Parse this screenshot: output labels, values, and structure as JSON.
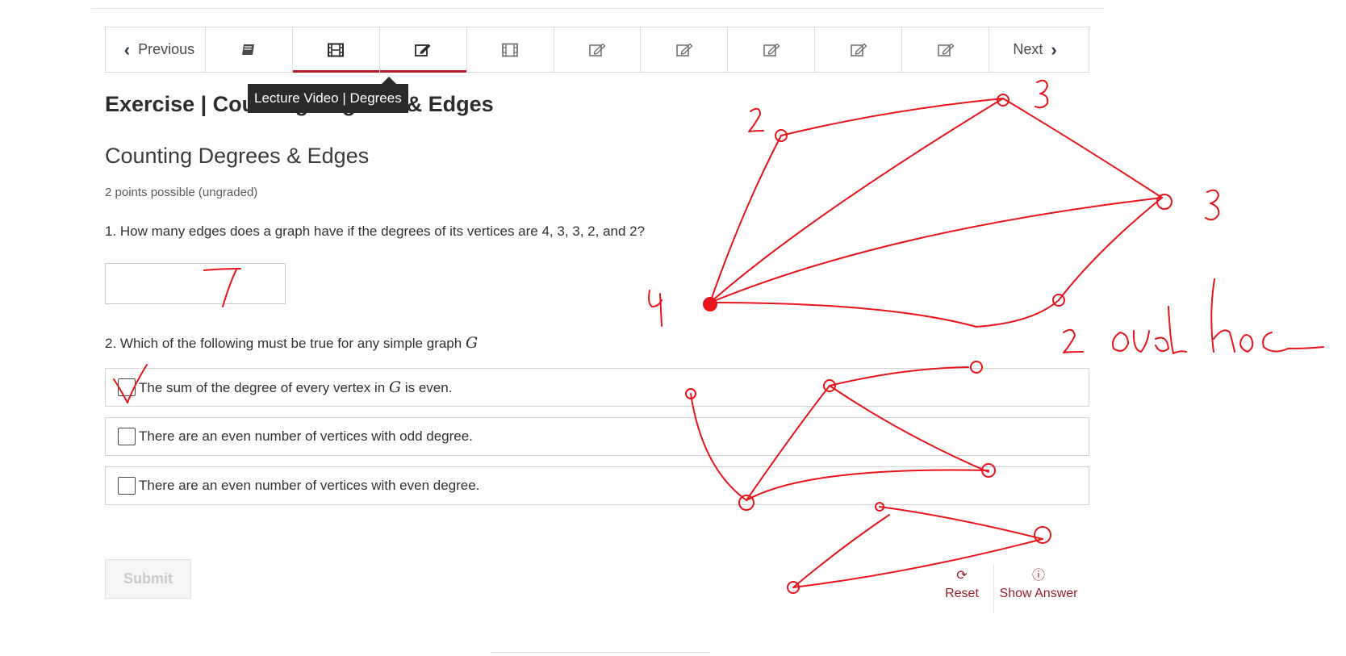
{
  "nav": {
    "previous_label": "Previous",
    "next_label": "Next",
    "units": [
      {
        "icon": "book-icon"
      },
      {
        "icon": "film-icon",
        "active": true
      },
      {
        "icon": "edit-icon",
        "underline": true
      },
      {
        "icon": "film-icon"
      },
      {
        "icon": "edit-icon"
      },
      {
        "icon": "edit-icon"
      },
      {
        "icon": "edit-icon"
      },
      {
        "icon": "edit-icon"
      }
    ],
    "tooltip": "Lecture Video | Degrees"
  },
  "page_title": "Exercise | Counting Degrees & Edges",
  "problem": {
    "title": "Counting Degrees & Edges",
    "points": "2 points possible (ungraded)",
    "q1": "1. How many edges does a graph have if the degrees of its vertices are 4, 3, 3, 2, and 2?",
    "q1_value": "",
    "q2_prefix": "2. Which of the following must be true for any simple graph ",
    "q2_var": "G",
    "choices": [
      {
        "before": "The sum of the degree of every vertex in ",
        "var": "G",
        "after": " is even."
      },
      {
        "before": "There are an even number of vertices with odd degree.",
        "var": "",
        "after": ""
      },
      {
        "before": "There are an even number of vertices with even degree.",
        "var": "",
        "after": ""
      }
    ]
  },
  "actions": {
    "submit": "Submit",
    "reset": "Reset",
    "show_answer": "Show Answer"
  },
  "colors": {
    "accent": "#b21f2d",
    "ink": "#e8141c",
    "action": "#9b1c2b"
  }
}
